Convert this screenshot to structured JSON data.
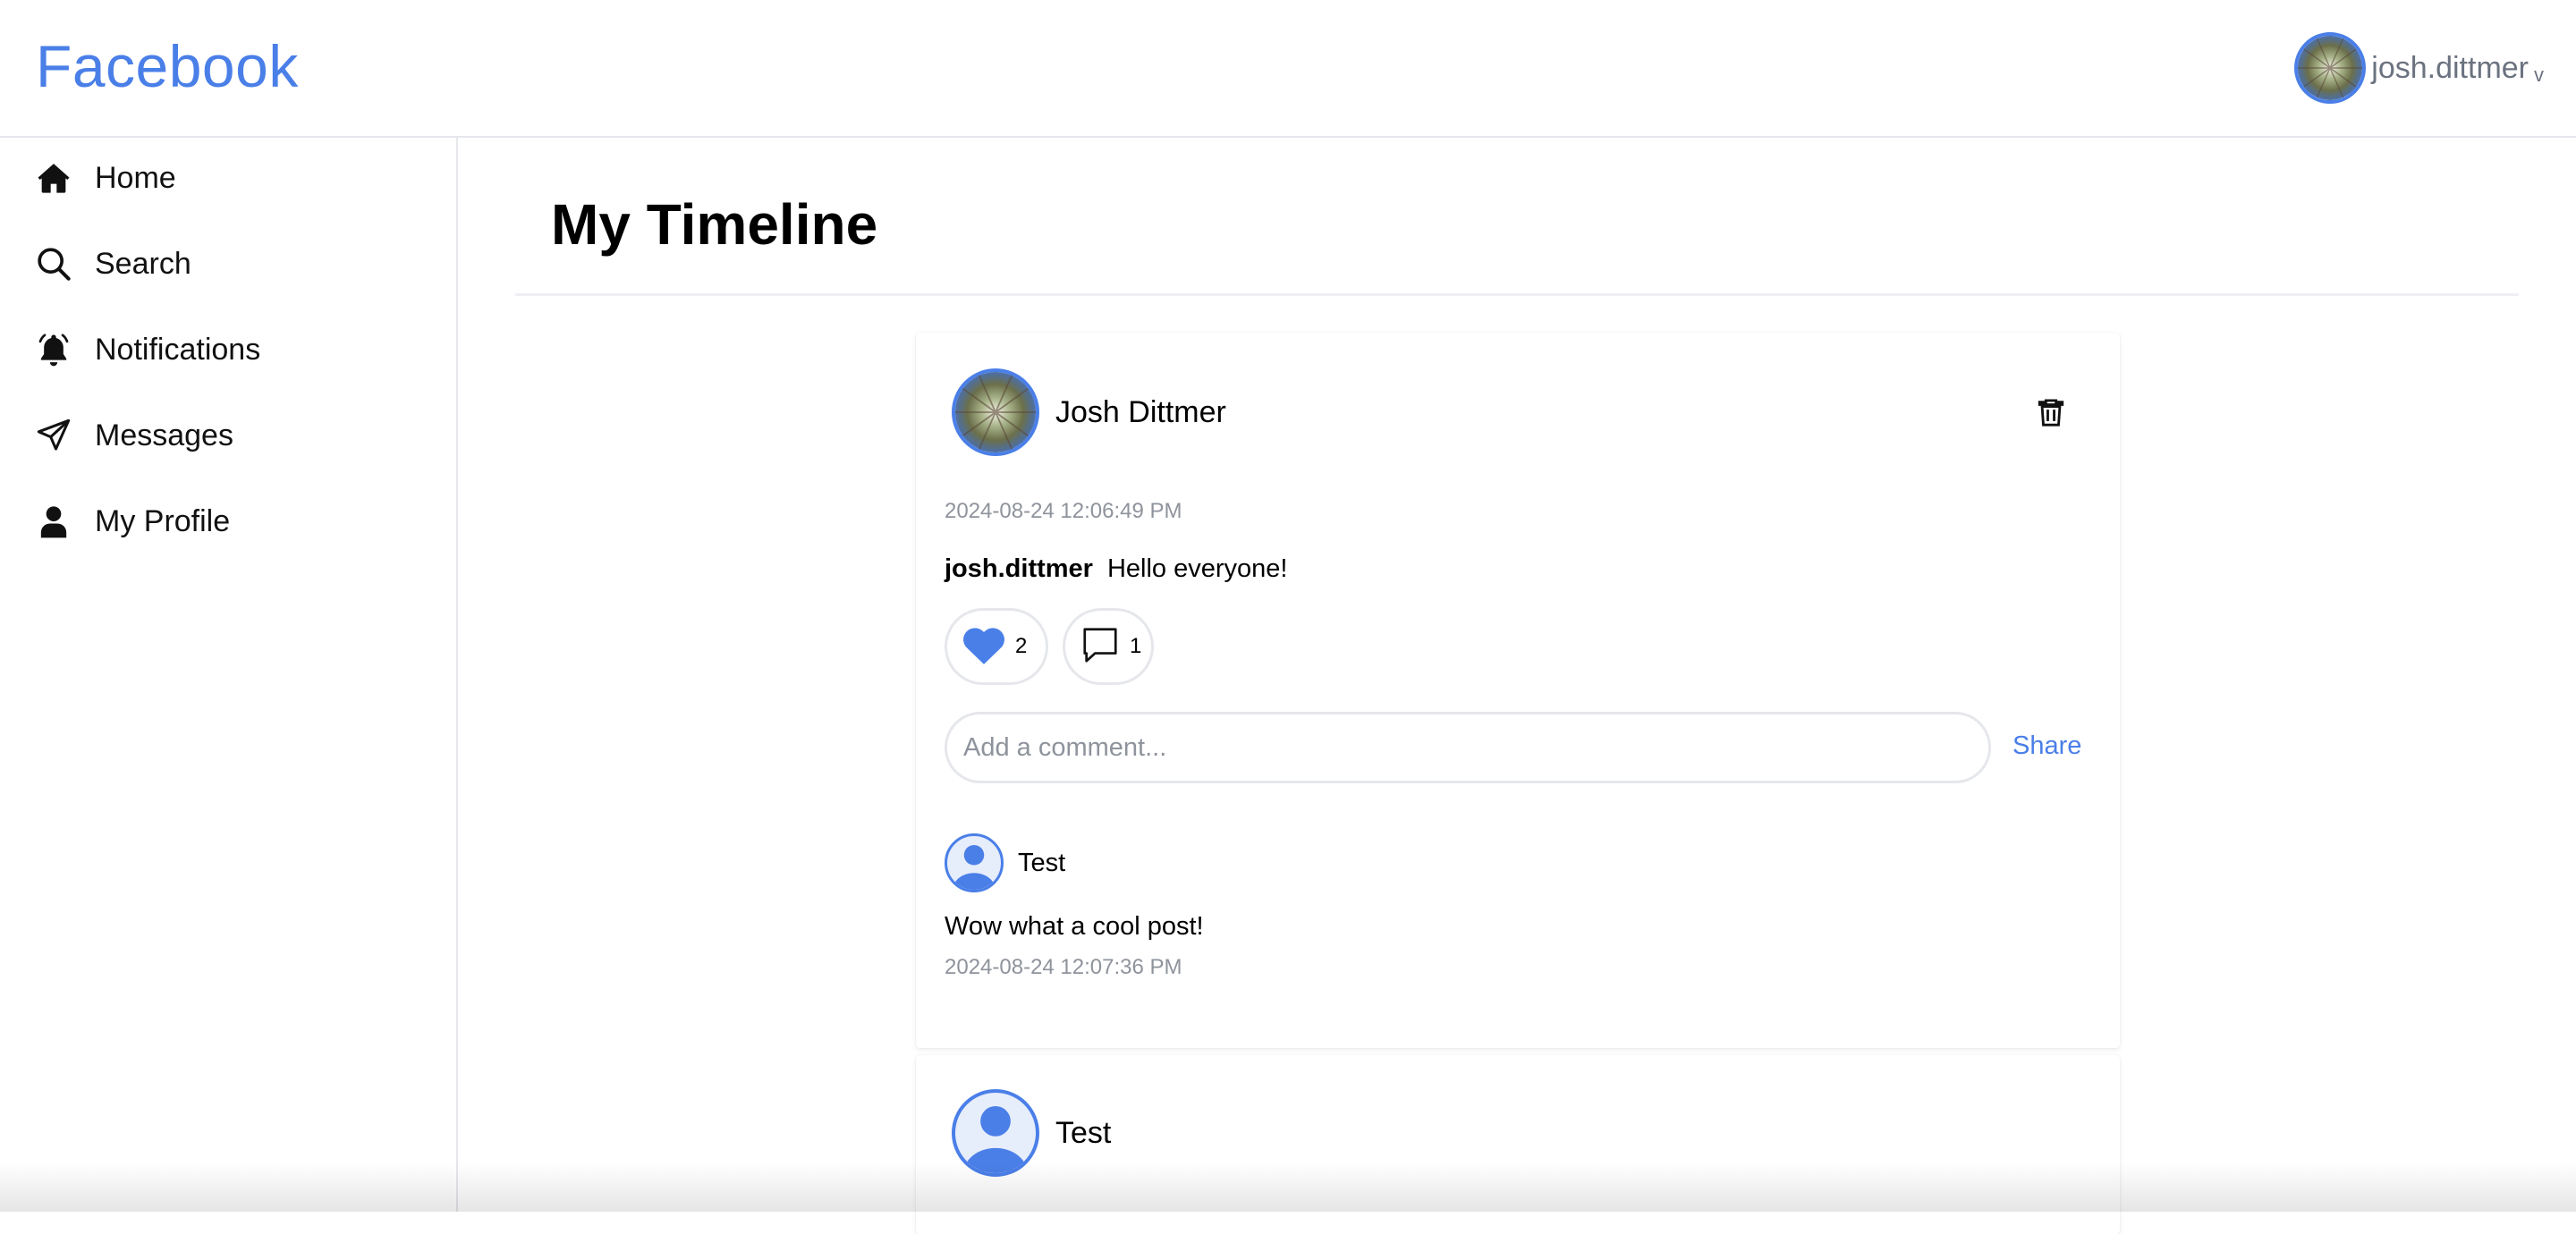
{
  "app": {
    "brand": "Facebook"
  },
  "user_menu": {
    "username": "josh.dittmer",
    "chevron": "v",
    "avatar_icon": "user-photo-avatar"
  },
  "sidebar": {
    "items": [
      {
        "label": "Home",
        "icon": "home-icon"
      },
      {
        "label": "Search",
        "icon": "search-icon"
      },
      {
        "label": "Notifications",
        "icon": "bell-icon"
      },
      {
        "label": "Messages",
        "icon": "send-icon"
      },
      {
        "label": "My Profile",
        "icon": "user-icon"
      }
    ]
  },
  "main": {
    "title": "My Timeline"
  },
  "posts": [
    {
      "author": "Josh Dittmer",
      "timestamp": "2024-08-24 12:06:49 PM",
      "handle": "josh.dittmer",
      "text": "Hello everyone!",
      "likes": "2",
      "comments_count": "1",
      "comment_placeholder": "Add a comment...",
      "share_label": "Share",
      "comments": [
        {
          "author": "Test",
          "text": "Wow what a cool post!",
          "timestamp": "2024-08-24 12:07:36 PM"
        }
      ]
    },
    {
      "author": "Test"
    }
  ],
  "colors": {
    "accent": "#4a7fe8",
    "muted_text": "#8e939c",
    "border": "#e5e7eb"
  }
}
